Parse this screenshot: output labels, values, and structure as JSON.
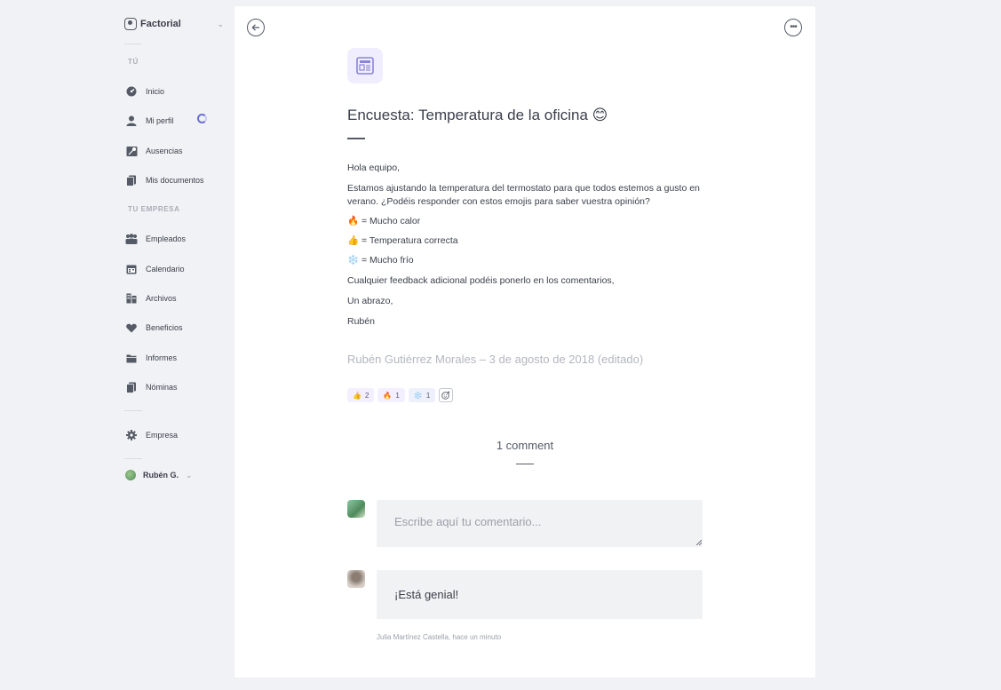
{
  "sidebar": {
    "brand": "Factorial",
    "section_you": "TÚ",
    "you_items": [
      {
        "label": "Inicio",
        "icon": "dashboard-gauge-icon"
      },
      {
        "label": "Mi perfil",
        "icon": "person-icon"
      },
      {
        "label": "Ausencias",
        "icon": "beach-icon"
      },
      {
        "label": "Mis documentos",
        "icon": "documents-icon"
      }
    ],
    "section_company": "TU EMPRESA",
    "company_items": [
      {
        "label": "Empleados",
        "icon": "people-icon"
      },
      {
        "label": "Calendario",
        "icon": "calendar-icon"
      },
      {
        "label": "Archivos",
        "icon": "archive-icon"
      },
      {
        "label": "Beneficios",
        "icon": "heart-icon"
      },
      {
        "label": "Informes",
        "icon": "folder-icon"
      },
      {
        "label": "Nóminas",
        "icon": "payslips-icon"
      }
    ],
    "settings_item": {
      "label": "Empresa",
      "icon": "gear-icon"
    },
    "user": {
      "name": "Rubén G."
    }
  },
  "post": {
    "title": "Encuesta: Temperatura de la oficina 😊",
    "body": [
      "Hola equipo,",
      "Estamos ajustando la temperatura del termostato para que todos estemos a gusto en verano. ¿Podéis responder con estos emojis para saber vuestra opinión?",
      "🔥 = Mucho calor",
      "👍 = Temperatura correcta",
      "❄️ = Mucho frío",
      "Cualquier feedback adicional podéis ponerlo en los comentarios,",
      "Un abrazo,",
      "Rubén"
    ],
    "author_line": "Rubén Gutiérrez Morales – 3 de agosto de 2018 (editado)",
    "reactions": [
      {
        "emoji": "👍",
        "count": "2"
      },
      {
        "emoji": "🔥",
        "count": "1"
      },
      {
        "emoji": "❄️",
        "count": "1"
      }
    ]
  },
  "comments": {
    "count_label": "1 comment",
    "input_placeholder": "Escribe aquí tu comentario...",
    "items": [
      {
        "text": "¡Está genial!",
        "meta": "Julia Martínez Castella, hace un minuto"
      }
    ]
  },
  "colors": {
    "accent": "#6b6fd4",
    "background": "#f1f2f5",
    "card": "#ffffff"
  }
}
